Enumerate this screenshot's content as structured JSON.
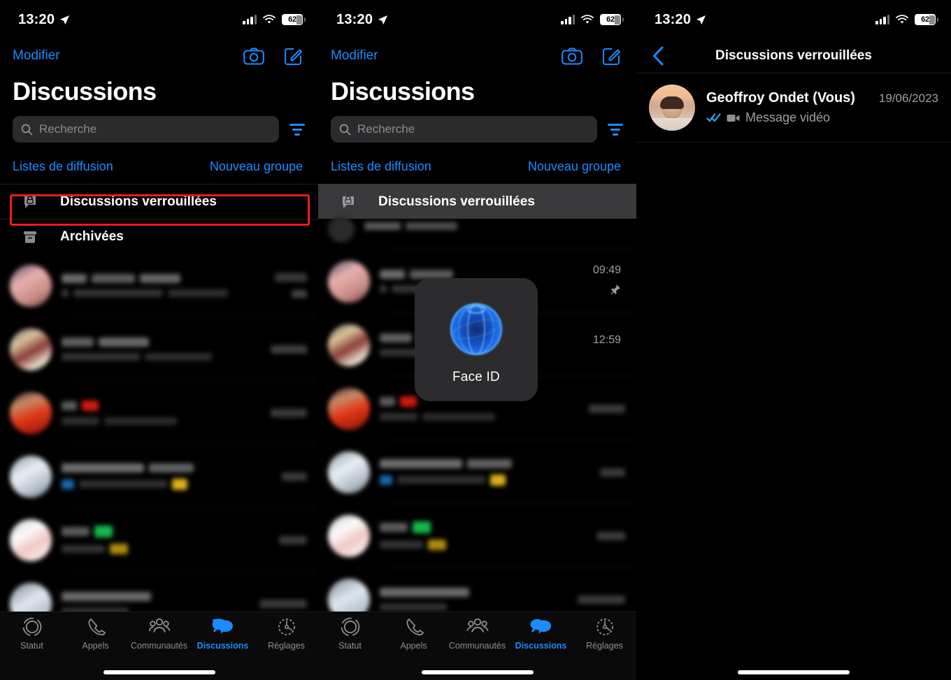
{
  "status_bar": {
    "time": "13:20",
    "battery": "62",
    "location_icon": "location-arrow-icon",
    "signal_icon": "cellular-signal-icon",
    "wifi_icon": "wifi-icon"
  },
  "panel1": {
    "nav": {
      "edit_label": "Modifier",
      "camera_icon": "camera-icon",
      "compose_icon": "compose-icon"
    },
    "title": "Discussions",
    "search": {
      "placeholder": "Recherche",
      "search_icon": "search-icon",
      "filter_icon": "filter-icon"
    },
    "quick_links": {
      "broadcast": "Listes de diffusion",
      "new_group": "Nouveau groupe"
    },
    "special_rows": [
      {
        "label": "Discussions verrouillées",
        "icon": "locked-chat-icon",
        "highlighted": true
      },
      {
        "label": "Archivées",
        "icon": "archive-box-icon",
        "highlighted": false
      }
    ],
    "annotation": {
      "type": "red-highlight-box",
      "color": "#ef1d16",
      "target": "Discussions verrouillées"
    }
  },
  "panel2": {
    "nav": {
      "edit_label": "Modifier",
      "camera_icon": "camera-icon",
      "compose_icon": "compose-icon"
    },
    "title": "Discussions",
    "search": {
      "placeholder": "Recherche",
      "search_icon": "search-icon",
      "filter_icon": "filter-icon"
    },
    "quick_links": {
      "broadcast": "Listes de diffusion",
      "new_group": "Nouveau groupe"
    },
    "special_rows": [
      {
        "label": "Discussions verrouillées",
        "icon": "locked-chat-icon",
        "pressed": true
      }
    ],
    "timestamps": [
      "09:49",
      "12:59"
    ],
    "pin_icon": "pin-icon",
    "face_id": {
      "label": "Face ID",
      "icon": "face-id-orb-icon"
    }
  },
  "panel3": {
    "nav": {
      "back_icon": "back-chevron-icon",
      "title": "Discussions verrouillées"
    },
    "chat": {
      "name": "Geoffroy Ondet (Vous)",
      "date": "19/06/2023",
      "preview": "Message vidéo",
      "read_icon": "double-check-read-icon",
      "media_icon": "video-camera-icon",
      "avatar": "contact-avatar"
    }
  },
  "tab_bar": {
    "items": [
      {
        "label": "Statut",
        "icon": "status-ring-icon",
        "active": false
      },
      {
        "label": "Appels",
        "icon": "phone-icon",
        "active": false
      },
      {
        "label": "Communautés",
        "icon": "communities-people-icon",
        "active": false
      },
      {
        "label": "Discussions",
        "icon": "chat-bubbles-icon",
        "active": true
      },
      {
        "label": "Réglages",
        "icon": "settings-gear-icon",
        "active": false
      }
    ]
  },
  "colors": {
    "accent": "#1a8cff",
    "annotation": "#ef1d16",
    "background": "#000000",
    "secondary_text": "#8e8e93",
    "pressed_row": "#3a3a3c"
  }
}
